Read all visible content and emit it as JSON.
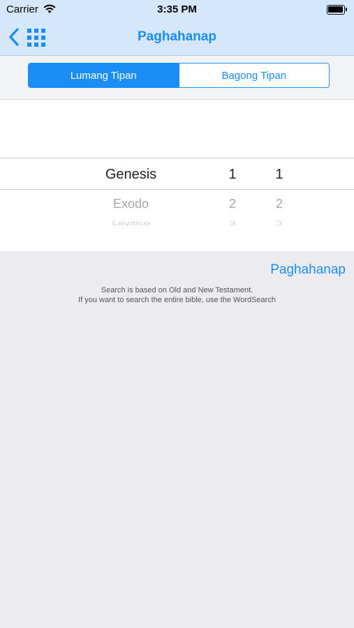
{
  "status_bar": {
    "carrier": "Carrier",
    "time": "3:35 PM"
  },
  "nav": {
    "title": "Paghahanap",
    "back_icon": "chevron-left-icon",
    "grid_icon": "grid-icon"
  },
  "segments": {
    "options": [
      "Lumang Tipan",
      "Bagong Tipan"
    ],
    "selected": "Lumang Tipan"
  },
  "picker": {
    "books": [
      "Genesis",
      "Exodo",
      "Levitico"
    ],
    "chapters": [
      "1",
      "2",
      "3"
    ],
    "verses": [
      "1",
      "2",
      "3"
    ],
    "selected_book": "Genesis",
    "selected_chapter": "1",
    "selected_verse": "1"
  },
  "search_button": "Paghahanap",
  "info": {
    "line1": "Search is based on Old and New Testament.",
    "line2": "If you want to search the entire bible, use the WordSearch"
  },
  "colors": {
    "accent": "#1a8ef5",
    "nav_bg": "#d5e7fb",
    "page_bg": "#ebebf0"
  }
}
